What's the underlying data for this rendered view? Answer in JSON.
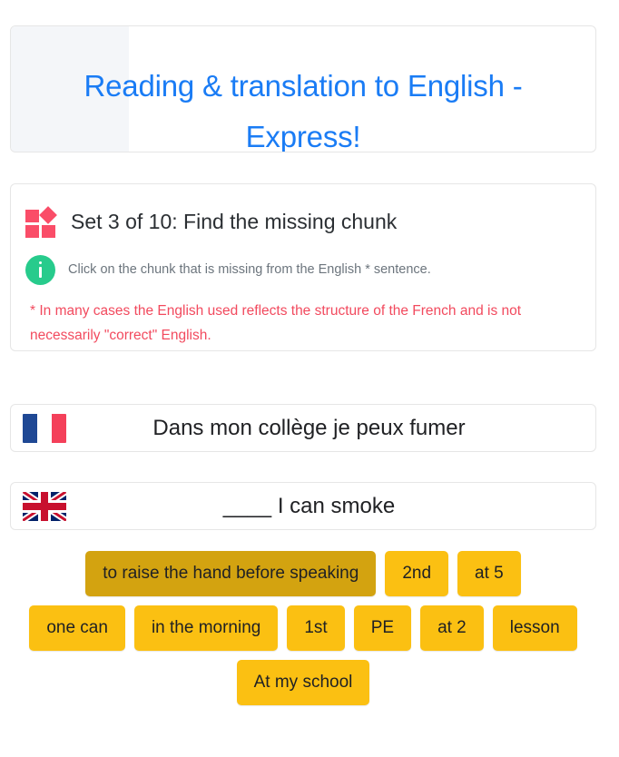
{
  "header": {
    "title": "Reading & translation to English - Express!",
    "accent_color": "#1a7cf5"
  },
  "instruction": {
    "set_title": "Set 3 of 10: Find the missing chunk",
    "set_icon": "chunk-squares-icon",
    "set_icon_color": "#fa4d68",
    "info_icon": "info-circle-icon",
    "info_icon_color": "#27cb8c",
    "info_text": "Click on the chunk that is missing from the English * sentence.",
    "footnote": "* In many cases the English used reflects the structure of the French and is not necessarily \"correct\" English.",
    "footnote_color": "#f24a5e"
  },
  "sentences": [
    {
      "flag": "france-flag",
      "language": "French",
      "text": "Dans mon collège je peux fumer"
    },
    {
      "flag": "united-kingdom-flag",
      "language": "English",
      "text": "____ I can smoke"
    }
  ],
  "chunks": {
    "default_color": "#fbc012",
    "selected_color": "#d3a310",
    "rows": [
      [
        {
          "label": "to raise the hand before speaking",
          "selected": true
        },
        {
          "label": "2nd",
          "selected": false
        },
        {
          "label": "at 5",
          "selected": false
        }
      ],
      [
        {
          "label": "one can",
          "selected": false
        },
        {
          "label": "in the morning",
          "selected": false
        },
        {
          "label": "1st",
          "selected": false
        },
        {
          "label": "PE",
          "selected": false
        },
        {
          "label": "at 2",
          "selected": false
        },
        {
          "label": "lesson",
          "selected": false
        }
      ],
      [
        {
          "label": "At my school",
          "selected": false
        }
      ]
    ]
  }
}
